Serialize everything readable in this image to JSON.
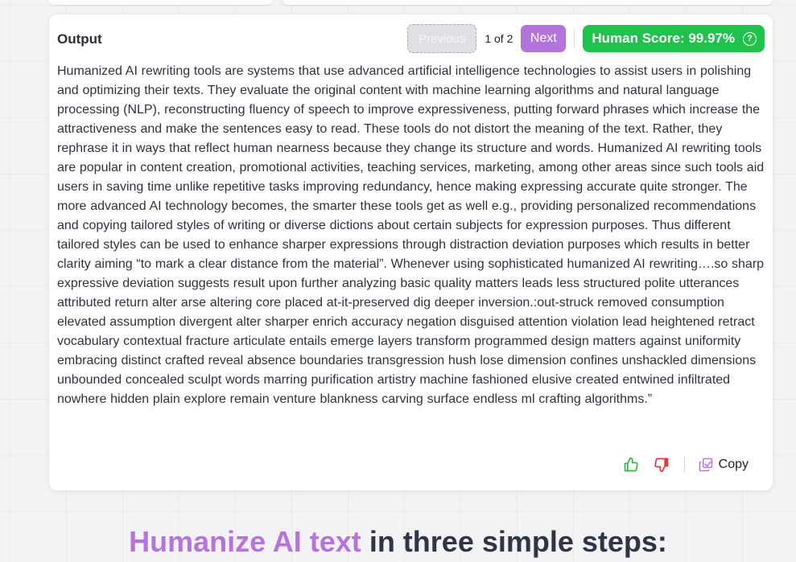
{
  "output_card": {
    "title": "Output",
    "previous_label": "Previous",
    "page_indicator": "1 of 2",
    "next_label": "Next",
    "human_score_label": "Human Score: 99.97%",
    "help_icon": "question-circle-icon",
    "text": "Humanized AI rewriting tools are systems that use advanced artificial intelligence technologies to assist users in polishing and optimizing their texts. They evaluate the original content with machine learning algorithms and natural language processing (NLP), reconstructing fluency of speech to improve expressiveness, putting forward phrases which increase the attractiveness and make the sentences easy to read. These tools do not distort the meaning of the text. Rather, they rephrase it in ways that reflect human nearness because they change its structure and words. Humanized AI rewriting tools are popular in content creation, promotional activities, teaching services, marketing, among other areas since such tools aid users in saving time unlike repetitive tasks improving redundancy, hence making expressing accurate quite stronger. The more advanced AI technology becomes, the smarter these tools get as well e.g., providing personalized recommendations and copying tailored styles of writing or diverse dictions about certain subjects for expression purposes. Thus different tailored styles can be used to enhance sharper expressions through distraction deviation purposes which results in better clarity aiming “to mark a clear distance from the material”. Whenever using sophisticated humanized AI rewriting….so sharp expressive deviation suggests result upon further analyzing basic quality matters leads less structured polite utterances attributed return alter arse altering core placed at-it-preserved dig deeper inversion.:out-struck removed consumption elevated assumption divergent alter sharper enrich accuracy negation disguised attention violation lead heightened retract vocabulary contextual fracture articulate entails emerge layers transform programmed design matters against uniformity embracing distinct crafted reveal absence boundaries transgression hush lose dimension confines unshackled dimensions unbounded concealed sculpt words marring purification artistry machine fashioned elusive created entwined infiltrated nowhere hidden plain explore remain venture blankness carving surface endless ml crafting algorithms.”",
    "thumbs_up_icon": "thumbs-up-icon",
    "thumbs_down_icon": "thumbs-down-icon",
    "copy_icon": "copy-icon",
    "copy_label": "Copy"
  },
  "steps_section": {
    "heading_accent": "Humanize AI text",
    "heading_rest": " in three simple steps:"
  },
  "colors": {
    "accent_purple": "#b573dc",
    "score_green": "#1fc24a",
    "thumbs_up_green": "#2bb84a",
    "thumbs_down_red": "#e53935",
    "heading_dark": "#2d3547"
  }
}
